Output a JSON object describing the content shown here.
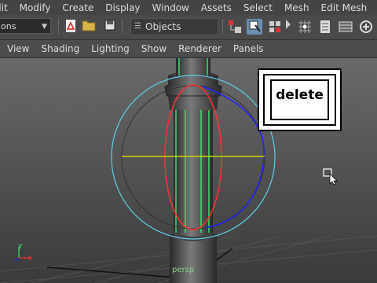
{
  "menubar": [
    "dit",
    "Modify",
    "Create",
    "Display",
    "Window",
    "Assets",
    "Select",
    "Mesh",
    "Edit Mesh"
  ],
  "toolbar": {
    "mode_value": "ons",
    "objects_label": "Objects"
  },
  "panel_menu": [
    "View",
    "Shading",
    "Lighting",
    "Show",
    "Renderer",
    "Panels"
  ],
  "viewport": {
    "camera_label": "persp",
    "axis_y": "y",
    "axis_x": "x",
    "overlay_key_label": "delete"
  },
  "colors": {
    "selection_wire": "#39e36b",
    "rotate_x": "#ff3030",
    "rotate_z": "#2020ff",
    "rotate_y": "#e6e600",
    "rotate_outer": "#5ad0e8"
  }
}
